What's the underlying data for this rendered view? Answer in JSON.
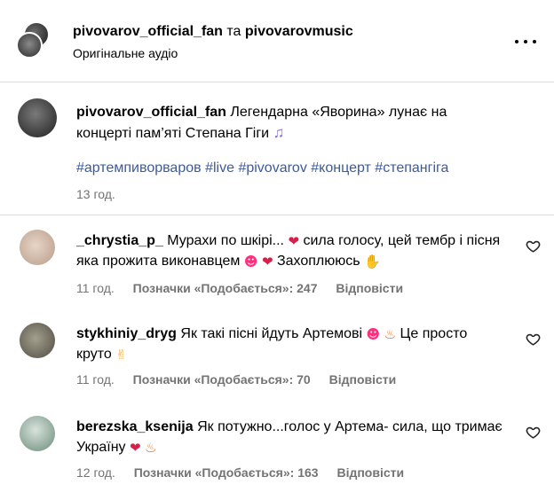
{
  "header": {
    "user1": "pivovarov_official_fan",
    "conjunction": "та",
    "user2": "pivovarovmusic",
    "audio": "Оригінальне аудіо"
  },
  "caption": {
    "username": "pivovarov_official_fan",
    "text": "Легендарна «Яворина» лунає на концерті пам’яті Степана Гіги",
    "hashtags": [
      "#артемпиворваров",
      "#live",
      "#pivovarov",
      "#концерт",
      "#степангіга"
    ],
    "time": "13 год."
  },
  "comments": [
    {
      "username": "_chrystia_p_",
      "text_a": "Мурахи по шкірі...",
      "text_b": "сила голосу, цей тембр і пісня яка прожита виконавцем",
      "text_c": "Захоплююсь",
      "time": "11 год.",
      "likes": "Позначки «Подобається»: 247",
      "reply": "Відповісти"
    },
    {
      "username": "stykhiniy_dryg",
      "text_a": "Як такі пісні йдуть Артемові",
      "text_b": "Це просто круто",
      "time": "11 год.",
      "likes": "Позначки «Подобається»: 70",
      "reply": "Відповісти"
    },
    {
      "username": "berezska_ksenija",
      "text_a": "Як потужно...голос у Артема- сила, що тримає Україну",
      "time": "12 год.",
      "likes": "Позначки «Подобається»: 163",
      "reply": "Відповісти"
    }
  ],
  "icons": {
    "more": "more-options-icon",
    "like": "heart-outline-icon",
    "music": "music-note-emoji",
    "broken_heart": "broken-heart-emoji",
    "heart_eyes": "heart-eyes-emoji",
    "fire": "fire-emoji",
    "hand": "hand-emoji",
    "clap": "clapping-emoji",
    "heart": "heart-emoji"
  },
  "colors": {
    "hashtag": "#3d5a99",
    "muted": "#737373",
    "divider": "#dbdbdb"
  }
}
